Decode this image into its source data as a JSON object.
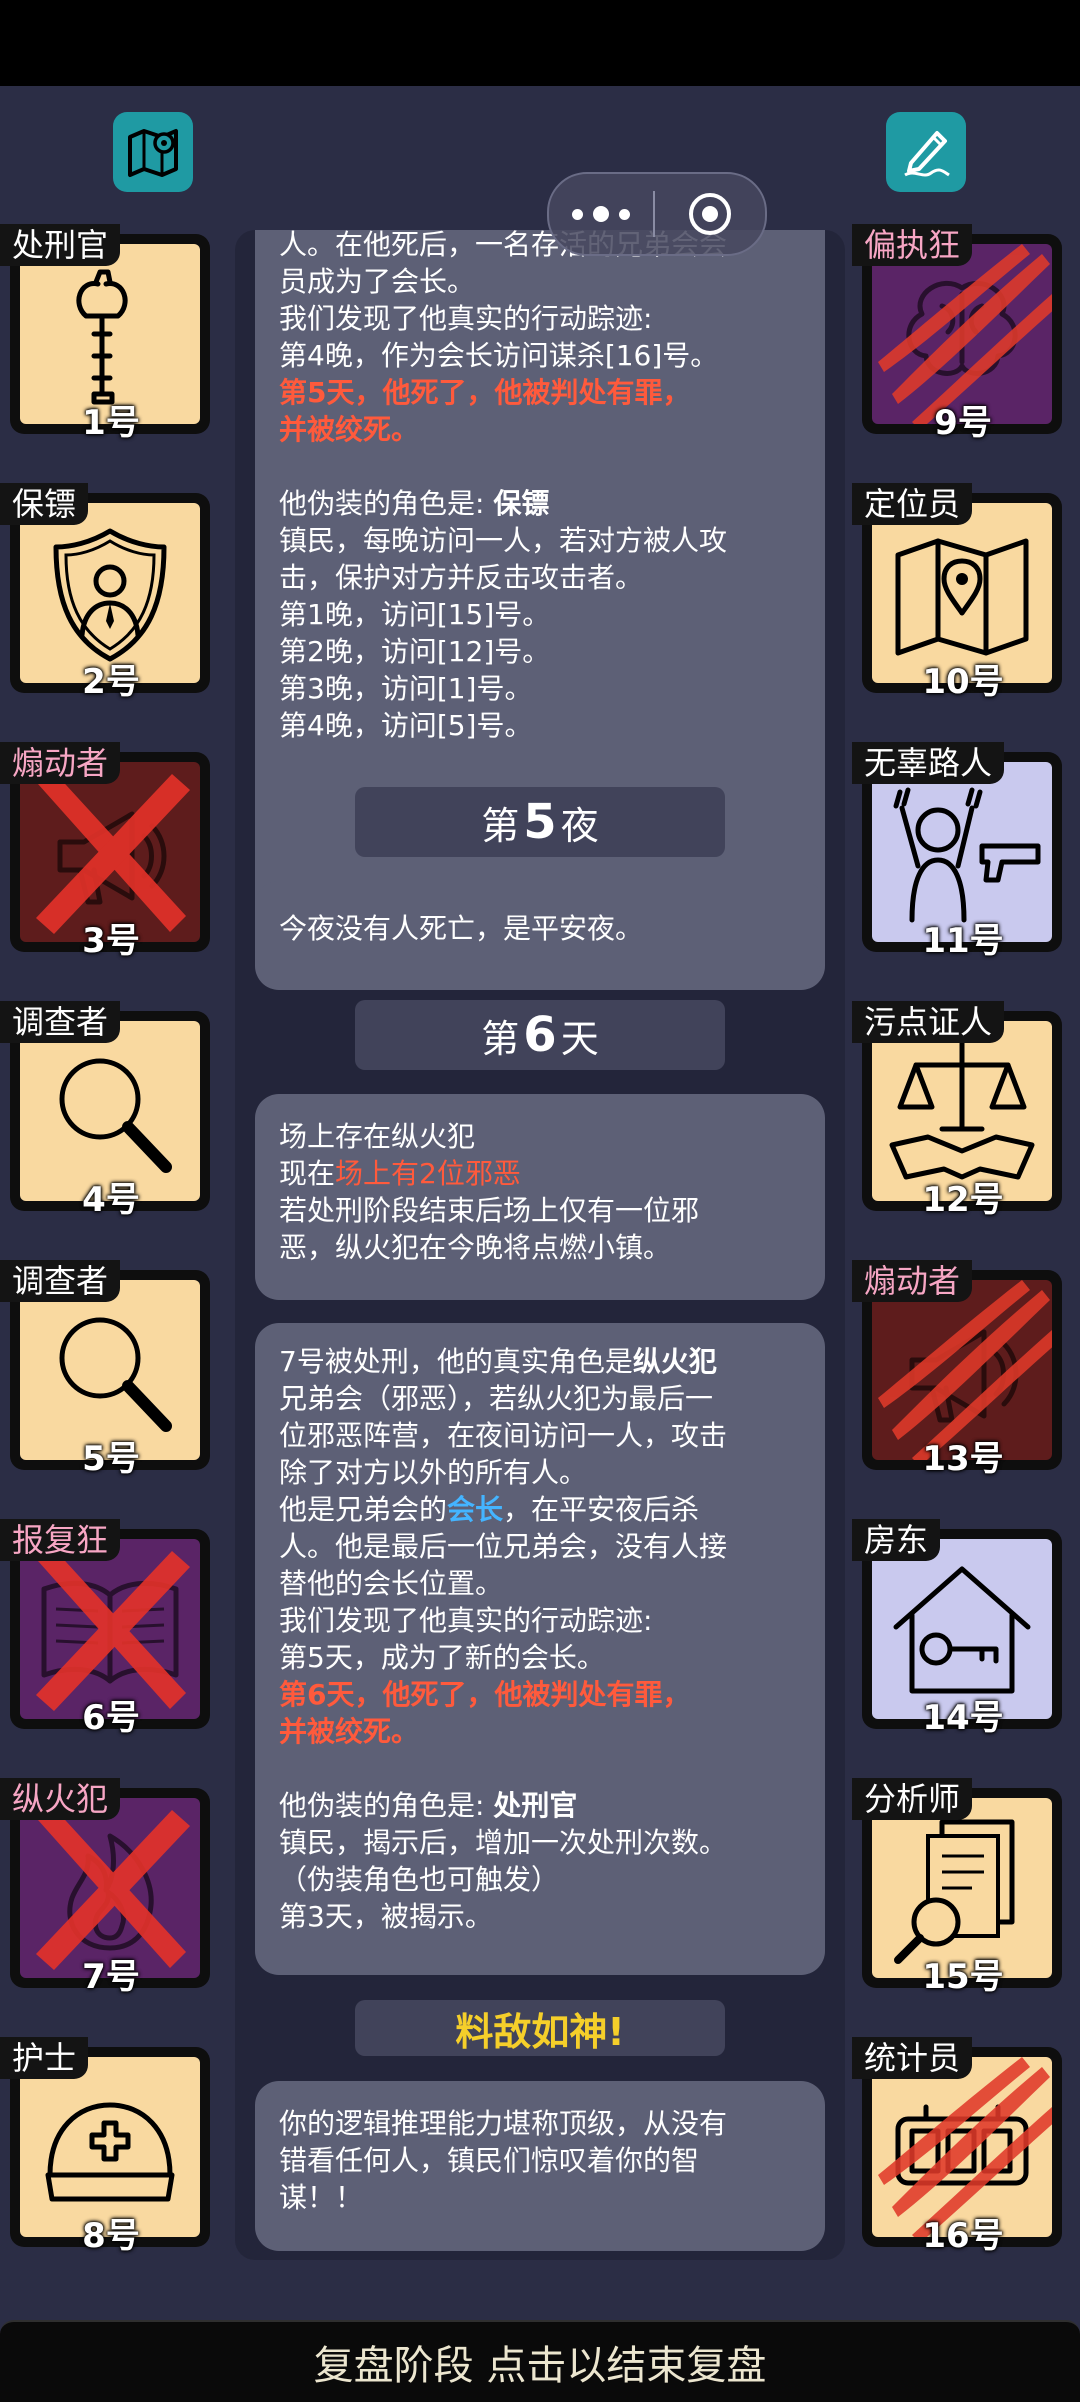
{
  "colors": {
    "background": "#2b2d45",
    "card": "#5d6076",
    "highlight_red": "#ff5a3c",
    "highlight_blue": "#44b4ff",
    "gold": "#f5cf2a",
    "tile_town": "#f9d9a0",
    "tile_neutral": "#c9c9ee",
    "tile_evil": "#5a2466",
    "tile_red": "#5e1c1c"
  },
  "toolbar": {
    "map_icon": "map-pin-icon",
    "note_icon": "edit-pen-icon"
  },
  "log": {
    "card1": {
      "partial_line": "人。在他死后，一名存活的兄弟会会",
      "lines": [
        "员成为了会长。",
        "我们发现了他真实的行动踪迹:",
        "第4晚，作为会长访问谋杀[16]号。"
      ],
      "death_line1": "第5天，他死了，他被判处有罪，",
      "death_line2": "并被绞死。",
      "disguise_prefix": "他伪装的角色是: ",
      "disguise_role": "保镖",
      "desc_line1": "镇民，每晚访问一人，若对方被人攻",
      "desc_line2": "击，保护对方并反击攻击者。",
      "visits": [
        "第1晚，访问[15]号。",
        "第2晚，访问[12]号。",
        "第3晚，访问[1]号。",
        "第4晚，访问[5]号。"
      ]
    },
    "night5": {
      "prefix": "第",
      "number": "5",
      "suffix": "夜"
    },
    "night5_text": "今夜没有人死亡，是平安夜。",
    "day6": {
      "prefix": "第",
      "number": "6",
      "suffix": "天"
    },
    "day6_card": {
      "line1": "场上存在纵火犯",
      "line2_prefix": "现在",
      "line2_highlight": "场上有2位邪恶",
      "line3": "若处刑阶段结束后场上仅有一位邪",
      "line4": "恶，纵火犯在今晚将点燃小镇。"
    },
    "card3": {
      "line1_prefix": "7号被处刑，他的真实角色是",
      "line1_role": "纵火犯",
      "line2": "兄弟会（邪恶），若纵火犯为最后一",
      "line3": "位邪恶阵营，在夜间访问一人，攻击",
      "line4": "除了对方以外的所有人。",
      "line5_prefix": "他是兄弟会的",
      "line5_highlight": "会长",
      "line5_suffix": "，在平安夜后杀",
      "line6": "人。他是最后一位兄弟会，没有人接",
      "line7": "替他的会长位置。",
      "line8": "我们发现了他真实的行动踪迹:",
      "line9": "第5天，成为了新的会长。",
      "death_line1": "第6天，他死了，他被判处有罪，",
      "death_line2": "并被绞死。",
      "disguise_prefix": "他伪装的角色是: ",
      "disguise_role": "处刑官",
      "desc_line1": "镇民，揭示后，增加一次处刑次数。",
      "desc_line2": "（伪装角色也可触发）",
      "desc_line3": "第3天，被揭示。"
    },
    "result_title": "料敌如神!",
    "result_text": [
      "你的逻辑推理能力堪称顶级，从没有",
      "错看任何人，镇民们惊叹着你的智",
      "谋！！"
    ]
  },
  "players": [
    {
      "num": "1号",
      "role": "处刑官",
      "icon": "axe-icon",
      "tile": "town",
      "mark": "none",
      "pink": false
    },
    {
      "num": "2号",
      "role": "保镖",
      "icon": "shield-icon",
      "tile": "town",
      "mark": "none",
      "pink": false
    },
    {
      "num": "3号",
      "role": "煽动者",
      "icon": "megaphone-icon",
      "tile": "red",
      "mark": "cross",
      "pink": true
    },
    {
      "num": "4号",
      "role": "调查者",
      "icon": "magnifier-icon",
      "tile": "town",
      "mark": "none",
      "pink": false
    },
    {
      "num": "5号",
      "role": "调查者",
      "icon": "magnifier-icon",
      "tile": "town",
      "mark": "none",
      "pink": false
    },
    {
      "num": "6号",
      "role": "报复狂",
      "icon": "book-icon",
      "tile": "evil",
      "mark": "cross",
      "pink": true
    },
    {
      "num": "7号",
      "role": "纵火犯",
      "icon": "fire-icon",
      "tile": "evil",
      "mark": "cross",
      "pink": true
    },
    {
      "num": "8号",
      "role": "护士",
      "icon": "nurse-cap-icon",
      "tile": "town",
      "mark": "none",
      "pink": false
    },
    {
      "num": "9号",
      "role": "偏执狂",
      "icon": "brain-icon",
      "tile": "evil",
      "mark": "claw",
      "pink": true
    },
    {
      "num": "10号",
      "role": "定位员",
      "icon": "map-pin-icon",
      "tile": "town",
      "mark": "none",
      "pink": false
    },
    {
      "num": "11号",
      "role": "无辜路人",
      "icon": "hands-up-gun-icon",
      "tile": "neutral",
      "mark": "none",
      "pink": false
    },
    {
      "num": "12号",
      "role": "污点证人",
      "icon": "scales-handshake-icon",
      "tile": "town",
      "mark": "none",
      "pink": false
    },
    {
      "num": "13号",
      "role": "煽动者",
      "icon": "megaphone-icon",
      "tile": "red",
      "mark": "claw",
      "pink": true
    },
    {
      "num": "14号",
      "role": "房东",
      "icon": "house-key-icon",
      "tile": "neutral",
      "mark": "none",
      "pink": false
    },
    {
      "num": "15号",
      "role": "分析师",
      "icon": "documents-magnifier-icon",
      "tile": "town",
      "mark": "none",
      "pink": false
    },
    {
      "num": "16号",
      "role": "统计员",
      "icon": "counter-icon",
      "tile": "town",
      "mark": "claw",
      "pink": false
    }
  ],
  "bottom_bar": "复盘阶段 点击以结束复盘"
}
